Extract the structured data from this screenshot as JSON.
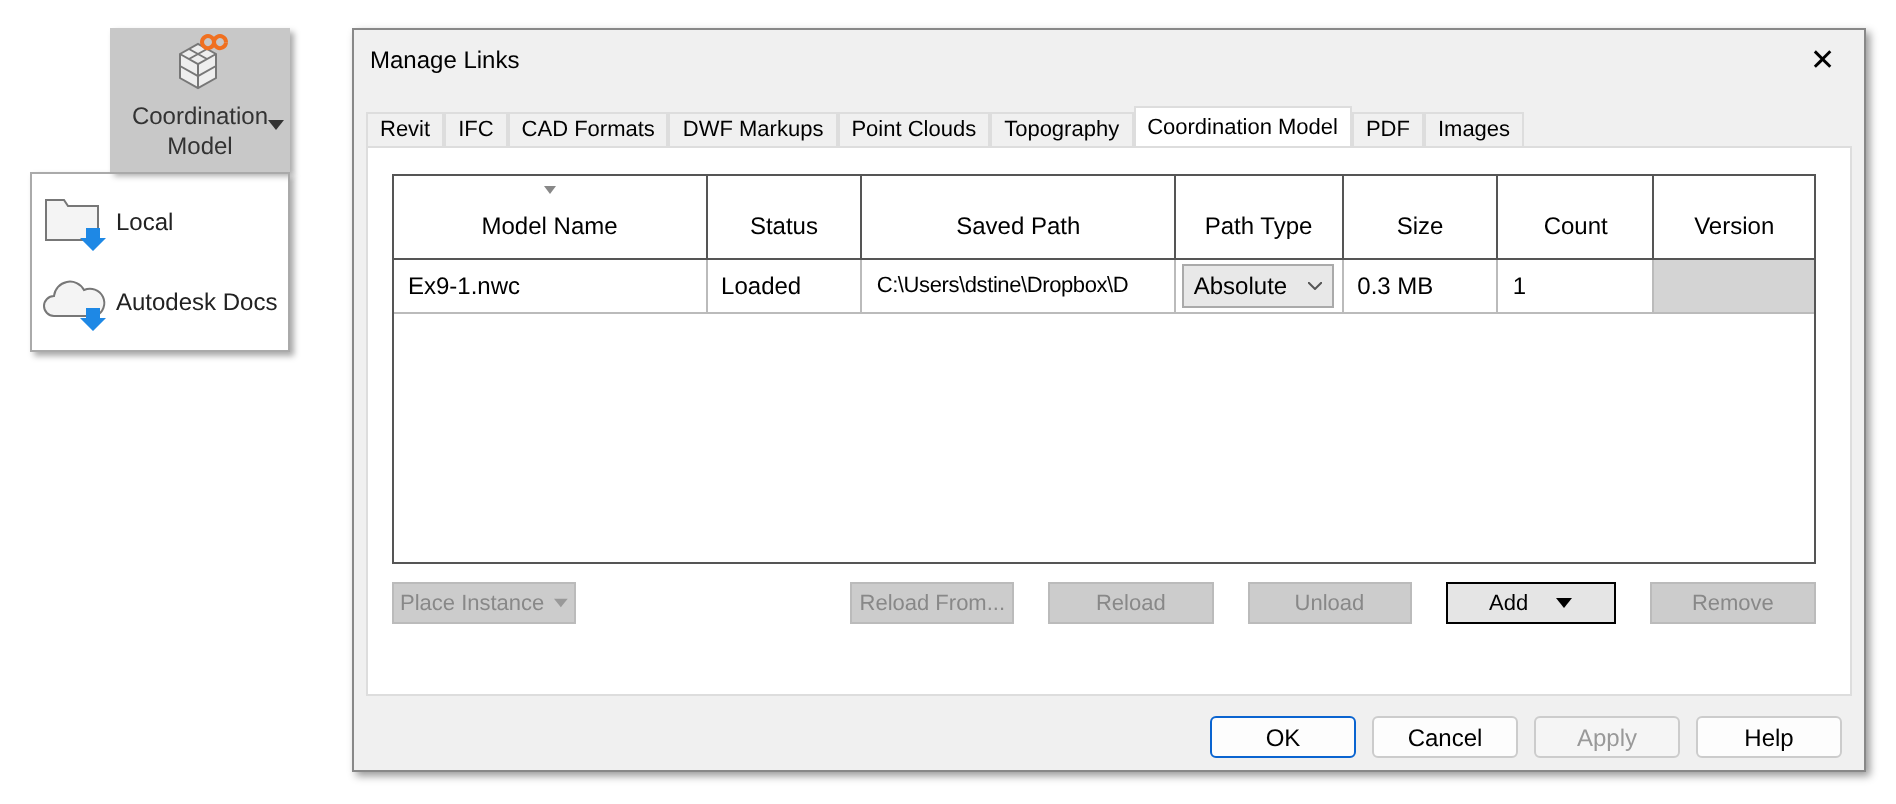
{
  "ribbon_button": {
    "label": "Coordination Model",
    "expanded": true
  },
  "ribbon_menu": [
    {
      "label": "Local",
      "kind": "folder"
    },
    {
      "label": "Autodesk Docs",
      "kind": "cloud"
    }
  ],
  "window": {
    "title": "Manage Links",
    "close": "✕"
  },
  "tabs": [
    {
      "label": "Revit",
      "selected": false
    },
    {
      "label": "IFC",
      "selected": false
    },
    {
      "label": "CAD Formats",
      "selected": false
    },
    {
      "label": "DWF Markups",
      "selected": false
    },
    {
      "label": "Point Clouds",
      "selected": false
    },
    {
      "label": "Topography",
      "selected": false
    },
    {
      "label": "Coordination Model",
      "selected": true
    },
    {
      "label": "PDF",
      "selected": false
    },
    {
      "label": "Images",
      "selected": false
    }
  ],
  "table": {
    "columns": [
      {
        "label": "Model Name",
        "sorted": true
      },
      {
        "label": "Status",
        "sorted": false
      },
      {
        "label": "Saved Path",
        "sorted": false
      },
      {
        "label": "Path Type",
        "sorted": false
      },
      {
        "label": "Size",
        "sorted": false
      },
      {
        "label": "Count",
        "sorted": false
      },
      {
        "label": "Version",
        "sorted": false
      }
    ],
    "rows": [
      {
        "model_name": "Ex9-1.nwc",
        "status": "Loaded",
        "saved_path": "C:\\Users\\dstine\\Dropbox\\D",
        "path_type": "Absolute",
        "size": "0.3 MB",
        "count": "1",
        "version_disabled": true
      }
    ]
  },
  "actions": [
    {
      "label": "Place Instance",
      "kind": "dropdown",
      "disabled": true
    },
    {
      "label": "Reload From...",
      "kind": "button",
      "disabled": true
    },
    {
      "label": "Reload",
      "kind": "button",
      "disabled": true
    },
    {
      "label": "Unload",
      "kind": "button",
      "disabled": true
    },
    {
      "label": "Add",
      "kind": "dropdown",
      "disabled": false
    },
    {
      "label": "Remove",
      "kind": "button",
      "disabled": true
    }
  ],
  "footer_buttons": [
    {
      "label": "OK",
      "default": true,
      "disabled": false
    },
    {
      "label": "Cancel",
      "default": false,
      "disabled": false
    },
    {
      "label": "Apply",
      "default": false,
      "disabled": true
    },
    {
      "label": "Help",
      "default": false,
      "disabled": false
    }
  ]
}
